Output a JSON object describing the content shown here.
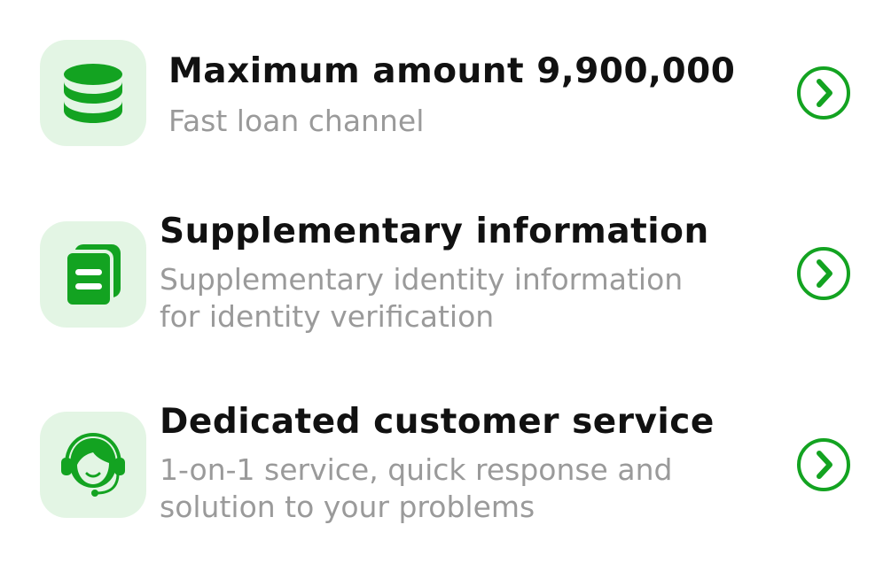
{
  "colors": {
    "accent": "#13a321",
    "tile_background": "#e3f5e4",
    "title_text": "#111111",
    "subtitle_text": "#9a9a9a"
  },
  "items": [
    {
      "icon": "database-stack-icon",
      "title": "Maximum amount 9,900,000",
      "subtitle_lines": [
        "Fast loan channel"
      ]
    },
    {
      "icon": "documents-icon",
      "title": "Supplementary information",
      "subtitle_lines": [
        "Supplementary identity information",
        "for identity verification"
      ]
    },
    {
      "icon": "headset-agent-icon",
      "title": "Dedicated customer service",
      "subtitle_lines": [
        "1-on-1 service, quick response and",
        "solution to your problems"
      ]
    }
  ],
  "action_icon": "chevron-right-circle-icon"
}
